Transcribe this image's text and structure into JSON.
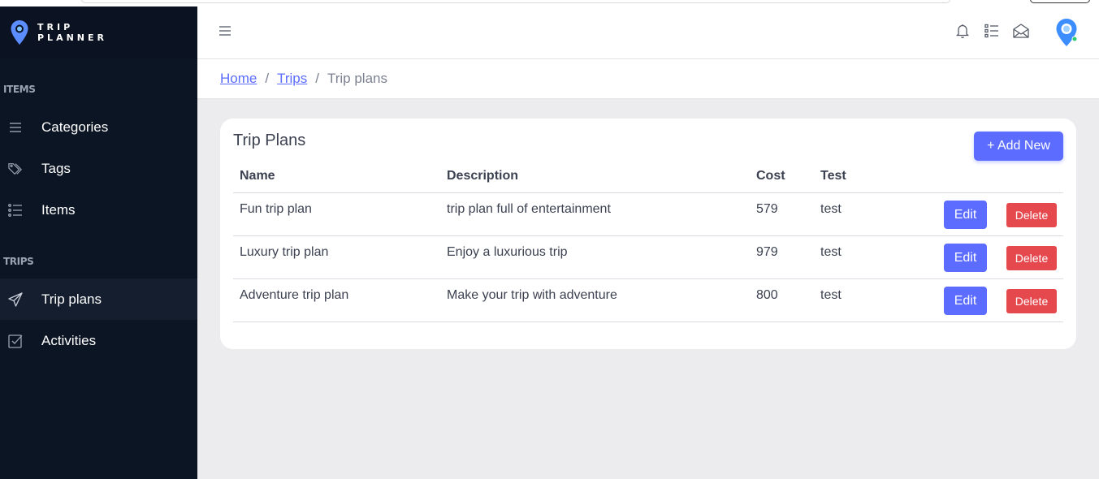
{
  "brand": {
    "line1": "TRIP",
    "line2": "PLANNER",
    "logo_icon": "map-pin-icon"
  },
  "sidebar": {
    "sections": [
      {
        "label": "ITEMS",
        "items": [
          {
            "label": "Categories",
            "icon": "list-icon"
          },
          {
            "label": "Tags",
            "icon": "tags-icon"
          },
          {
            "label": "Items",
            "icon": "list-check-icon"
          }
        ]
      },
      {
        "label": "TRIPS",
        "items": [
          {
            "label": "Trip plans",
            "icon": "send-icon",
            "active": true
          },
          {
            "label": "Activities",
            "icon": "check-square-icon"
          }
        ]
      }
    ]
  },
  "header": {
    "icons": [
      "hamburger-icon",
      "bell-icon",
      "list-icon",
      "envelope-open-icon",
      "avatar-pin-icon"
    ]
  },
  "breadcrumb": {
    "home": "Home",
    "trips": "Trips",
    "current": "Trip plans",
    "separator": "/"
  },
  "card": {
    "title": "Trip Plans",
    "add_label": "+ Add New"
  },
  "table": {
    "columns": [
      "Name",
      "Description",
      "Cost",
      "Test"
    ],
    "rows": [
      {
        "name": "Fun trip plan",
        "description": "trip plan full of entertainment",
        "cost": "579",
        "test": "test"
      },
      {
        "name": "Luxury trip plan",
        "description": "Enjoy a luxurious trip",
        "cost": "979",
        "test": "test"
      },
      {
        "name": "Adventure trip plan",
        "description": "Make your trip with adventure",
        "cost": "800",
        "test": "test"
      }
    ],
    "edit_label": "Edit",
    "delete_label": "Delete"
  },
  "colors": {
    "sidebar_bg": "#0c1524",
    "primary": "#5b6cff",
    "danger": "#e5484d",
    "page_bg": "#ececee"
  }
}
